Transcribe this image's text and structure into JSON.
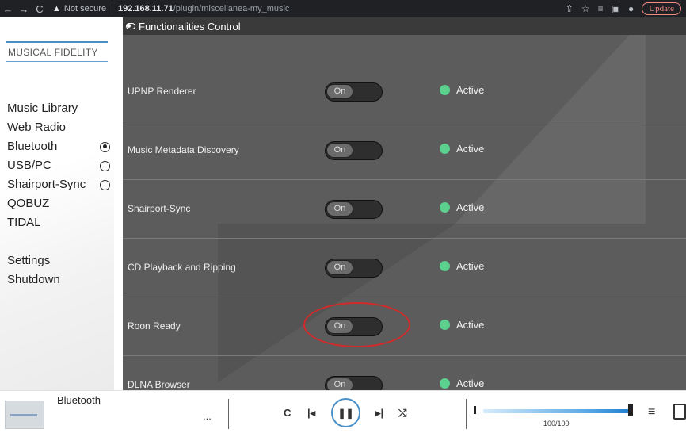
{
  "browser": {
    "not_secure": "Not secure",
    "url_host": "192.168.11.71",
    "url_path": "/plugin/miscellanea-my_music",
    "update_label": "Update"
  },
  "sidebar": {
    "brand": "MUSICAL FIDELITY",
    "items": [
      {
        "label": "Music Library"
      },
      {
        "label": "Web Radio"
      },
      {
        "label": "Bluetooth",
        "radio": "selected"
      },
      {
        "label": "USB/PC",
        "radio": "unselected"
      },
      {
        "label": "Shairport-Sync",
        "radio": "unselected"
      },
      {
        "label": "QOBUZ"
      },
      {
        "label": "TIDAL"
      },
      {
        "label": "Settings"
      },
      {
        "label": "Shutdown"
      }
    ]
  },
  "main": {
    "title": "Functionalities Control",
    "rows": [
      {
        "label": "UPNP Renderer",
        "switch": "On",
        "status": "Active"
      },
      {
        "label": "Music Metadata Discovery",
        "switch": "On",
        "status": "Active"
      },
      {
        "label": "Shairport-Sync",
        "switch": "On",
        "status": "Active"
      },
      {
        "label": "CD Playback and Ripping",
        "switch": "On",
        "status": "Active"
      },
      {
        "label": "Roon Ready",
        "switch": "On",
        "status": "Active",
        "highlighted": true
      },
      {
        "label": "DLNA Browser",
        "switch": "On",
        "status": "Active"
      }
    ],
    "status_color": "#5bd08f",
    "highlight_color": "#d02a2a"
  },
  "player": {
    "source": "Bluetooth",
    "more": "...",
    "volume": "100/100",
    "volume_fraction": 1.0,
    "accent": "#4a90c8"
  }
}
